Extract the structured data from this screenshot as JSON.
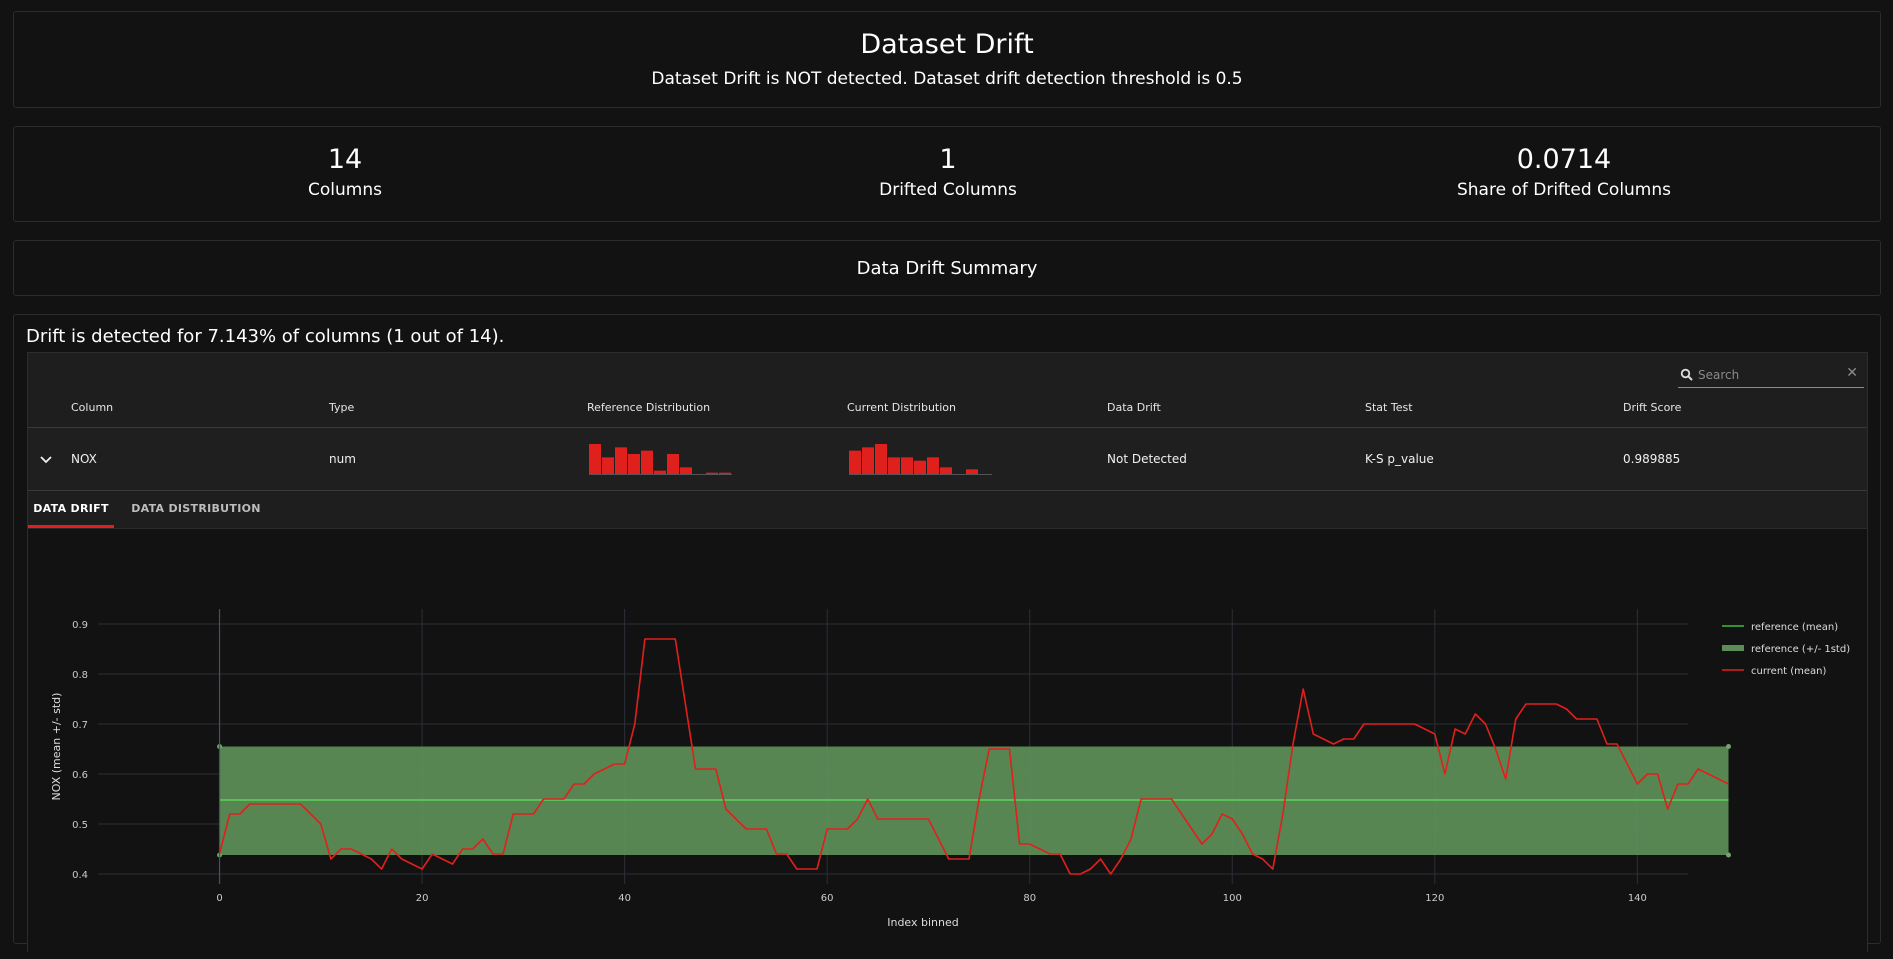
{
  "header": {
    "title": "Dataset Drift",
    "subtitle": "Dataset Drift is NOT detected. Dataset drift detection threshold is 0.5"
  },
  "counters": [
    {
      "value": "14",
      "label": "Columns"
    },
    {
      "value": "1",
      "label": "Drifted Columns"
    },
    {
      "value": "0.0714",
      "label": "Share of Drifted Columns"
    }
  ],
  "summary_title": "Data Drift Summary",
  "drift_text": "Drift is detected for 7.143% of columns (1 out of 14).",
  "search": {
    "placeholder": "Search"
  },
  "table": {
    "headers": [
      "Column",
      "Type",
      "Reference Distribution",
      "Current Distribution",
      "Data Drift",
      "Stat Test",
      "Drift Score"
    ],
    "row": {
      "column": "NOX",
      "type": "num",
      "data_drift": "Not Detected",
      "stat_test": "K-S p_value",
      "drift_score": "0.989885",
      "reference_hist": [
        9,
        5,
        8,
        6,
        7,
        1,
        6,
        2,
        0,
        0.4,
        0.4,
        0
      ],
      "current_hist": [
        7,
        8,
        9,
        5,
        5,
        4,
        5,
        2,
        0,
        1.4,
        0,
        0
      ]
    }
  },
  "tabs": {
    "active": "DATA DRIFT",
    "other": "DATA DISTRIBUTION"
  },
  "colors": {
    "accent": "#e0201c",
    "reference_band": "#5d8d57",
    "reference_line": "#5bd35b",
    "current": "#e0201c"
  },
  "chart_data": {
    "type": "line",
    "xlabel": "Index binned",
    "ylabel": "NOX (mean +/- std)",
    "xlim": [
      -12,
      145
    ],
    "ylim": [
      0.38,
      0.93
    ],
    "xticks": [
      0,
      20,
      40,
      60,
      80,
      100,
      120,
      140
    ],
    "yticks": [
      0.4,
      0.5,
      0.6,
      0.7,
      0.8,
      0.9
    ],
    "legend": [
      "reference (mean)",
      "reference (+/- 1std)",
      "current (mean)"
    ],
    "legend_position": "top-right",
    "reference": {
      "mean": 0.548,
      "lower": 0.438,
      "upper": 0.655,
      "x_range": [
        0,
        149
      ]
    },
    "series": [
      {
        "name": "current (mean)",
        "x": [
          0,
          1,
          2,
          3,
          4,
          5,
          6,
          7,
          8,
          9,
          10,
          11,
          12,
          13,
          14,
          15,
          16,
          17,
          18,
          19,
          20,
          21,
          22,
          23,
          24,
          25,
          26,
          27,
          28,
          29,
          30,
          31,
          32,
          33,
          34,
          35,
          36,
          37,
          38,
          39,
          40,
          41,
          42,
          43,
          44,
          45,
          46,
          47,
          48,
          49,
          50,
          51,
          52,
          53,
          54,
          55,
          56,
          57,
          58,
          59,
          60,
          61,
          62,
          63,
          64,
          65,
          66,
          67,
          68,
          69,
          70,
          71,
          72,
          73,
          74,
          75,
          76,
          77,
          78,
          79,
          80,
          81,
          82,
          83,
          84,
          85,
          86,
          87,
          88,
          89,
          90,
          91,
          92,
          93,
          94,
          95,
          96,
          97,
          98,
          99,
          100,
          101,
          102,
          103,
          104,
          105,
          106,
          107,
          108,
          109,
          110,
          111,
          112,
          113,
          114,
          115,
          116,
          117,
          118,
          119,
          120,
          121,
          122,
          123,
          124,
          125,
          126,
          127,
          128,
          129,
          130,
          131,
          132,
          133,
          134,
          135,
          136,
          137,
          138,
          139,
          140,
          141,
          142,
          143,
          144,
          145,
          146,
          147,
          148,
          149
        ],
        "y": [
          0.44,
          0.52,
          0.52,
          0.54,
          0.54,
          0.54,
          0.54,
          0.54,
          0.54,
          0.52,
          0.5,
          0.43,
          0.45,
          0.45,
          0.44,
          0.43,
          0.41,
          0.45,
          0.43,
          0.42,
          0.41,
          0.44,
          0.43,
          0.42,
          0.45,
          0.45,
          0.47,
          0.44,
          0.44,
          0.52,
          0.52,
          0.52,
          0.55,
          0.55,
          0.55,
          0.58,
          0.58,
          0.6,
          0.61,
          0.62,
          0.62,
          0.7,
          0.87,
          0.87,
          0.87,
          0.87,
          0.74,
          0.61,
          0.61,
          0.61,
          0.53,
          0.51,
          0.49,
          0.49,
          0.49,
          0.44,
          0.44,
          0.41,
          0.41,
          0.41,
          0.49,
          0.49,
          0.49,
          0.51,
          0.55,
          0.51,
          0.51,
          0.51,
          0.51,
          0.51,
          0.51,
          0.47,
          0.43,
          0.43,
          0.43,
          0.55,
          0.65,
          0.65,
          0.65,
          0.46,
          0.46,
          0.45,
          0.44,
          0.44,
          0.4,
          0.4,
          0.41,
          0.43,
          0.4,
          0.43,
          0.47,
          0.55,
          0.55,
          0.55,
          0.55,
          0.52,
          0.49,
          0.46,
          0.48,
          0.52,
          0.51,
          0.48,
          0.44,
          0.43,
          0.41,
          0.52,
          0.66,
          0.77,
          0.68,
          0.67,
          0.66,
          0.67,
          0.67,
          0.7,
          0.7,
          0.7,
          0.7,
          0.7,
          0.7,
          0.69,
          0.68,
          0.6,
          0.69,
          0.68,
          0.72,
          0.7,
          0.65,
          0.59,
          0.71,
          0.74,
          0.74,
          0.74,
          0.74,
          0.73,
          0.71,
          0.71,
          0.71,
          0.66,
          0.66,
          0.62,
          0.58,
          0.6,
          0.6,
          0.53,
          0.58,
          0.58,
          0.61,
          0.6,
          0.59,
          0.58
        ]
      }
    ]
  }
}
